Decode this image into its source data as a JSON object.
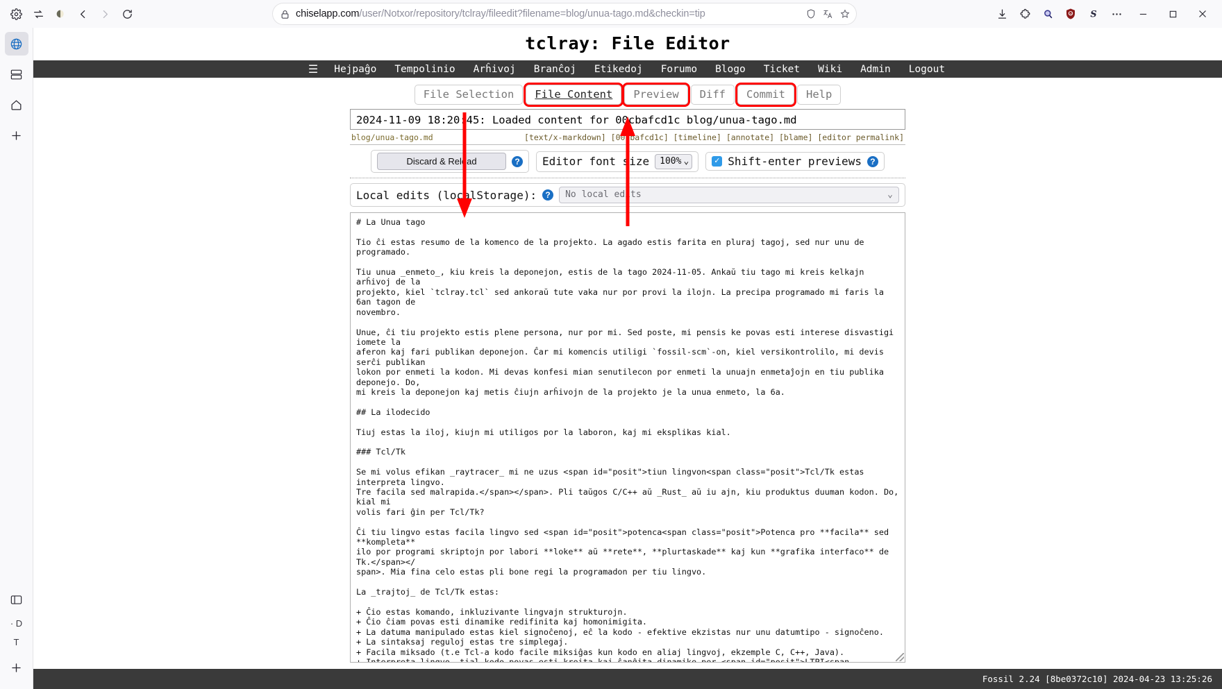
{
  "browser": {
    "url_host": "chiselapp.com",
    "url_path": "/user/Notxor/repository/tclray/fileedit?filename=blog/unua-tago.md&checkin=tip",
    "icons": {
      "settings": "gear-icon",
      "sync": "sync-icon",
      "profile": "profile-icon",
      "back": "back-arrow-icon",
      "forward": "forward-arrow-icon",
      "reload": "reload-icon",
      "lock": "lock-icon",
      "shield": "shield-icon",
      "translate": "translate-icon",
      "bookmark": "star-icon",
      "downloads": "download-icon",
      "extensions": "extensions-icon",
      "search": "search-icon",
      "ublock": "ublock-origin-icon",
      "stylus": "stylus-icon",
      "overflow": "more-options-icon",
      "minimize": "minimize-icon",
      "maximize": "maximize-icon",
      "close": "close-icon"
    },
    "sidebar": {
      "items": [
        {
          "name": "web-panel-icon",
          "glyph": "globe"
        },
        {
          "name": "tab-stack-icon",
          "glyph": "stack"
        },
        {
          "name": "home-icon",
          "glyph": "home"
        },
        {
          "name": "add-icon",
          "glyph": "plus"
        }
      ],
      "bottom": [
        {
          "name": "panel-toggle-icon",
          "glyph": "panel"
        },
        {
          "name": "workspace-d-label",
          "glyph": "text",
          "label": "· D"
        },
        {
          "name": "workspace-t-label",
          "glyph": "text",
          "label": "T"
        },
        {
          "name": "add-workspace-icon",
          "glyph": "plus"
        }
      ]
    }
  },
  "page": {
    "title": "tclray: File Editor",
    "nav": [
      {
        "label": "☰",
        "name": "sidebar-menu"
      },
      {
        "label": "Hejpaĝo",
        "name": "home"
      },
      {
        "label": "Tempolinio",
        "name": "timeline"
      },
      {
        "label": "Arĥivoj",
        "name": "files"
      },
      {
        "label": "Branĉoj",
        "name": "branches"
      },
      {
        "label": "Etikedoj",
        "name": "tags"
      },
      {
        "label": "Forumo",
        "name": "forum"
      },
      {
        "label": "Blogo",
        "name": "blog"
      },
      {
        "label": "Ticket",
        "name": "ticket"
      },
      {
        "label": "Wiki",
        "name": "wiki"
      },
      {
        "label": "Admin",
        "name": "admin"
      },
      {
        "label": "Logout",
        "name": "logout"
      }
    ],
    "tabs": [
      {
        "label": "File Selection",
        "selected": false,
        "highlighted": false
      },
      {
        "label": "File Content",
        "selected": true,
        "highlighted": true
      },
      {
        "label": "Preview",
        "selected": false,
        "highlighted": true
      },
      {
        "label": "Diff",
        "selected": false,
        "highlighted": false
      },
      {
        "label": "Commit",
        "selected": false,
        "highlighted": true
      },
      {
        "label": "Help",
        "selected": false,
        "highlighted": false
      }
    ],
    "status_message": "2024-11-09 18:20:45: Loaded content for 00cbafcd1c blog/unua-tago.md",
    "meta_left": "blog/unua-tago.md",
    "meta_right": "[text/x-markdown] [00cbafcd1c] [timeline] [annotate] [blame] [editor permalink]",
    "toolbar": {
      "discard_label": "Discard & Reload",
      "help_glyph": "?",
      "font_size_label": "Editor font size",
      "font_size_value": "100%",
      "shift_enter_label": "Shift-enter previews",
      "shift_enter_checked": true,
      "check_glyph": "✓"
    },
    "local_edits": {
      "label": "Local edits (localStorage):",
      "select_value": "No local edits"
    },
    "editor_content": "# La Unua tago\n\nTio ĉi estas resumo de la komenco de la projekto. La agado estis farita en pluraj tagoj, sed nur unu de programado.\n\nTiu unua _enmeto_, kiu kreis la deponejon, estis de la tago 2024-11-05. Ankaŭ tiu tago mi kreis kelkajn arĥivoj de la\nprojekto, kiel `tclray.tcl` sed ankoraŭ tute vaka nur por provi la ilojn. La precipa programado mi faris la 6an tagon de\nnovembro.\n\nUnue, ĉi tiu projekto estis plene persona, nur por mi. Sed poste, mi pensis ke povas esti interese disvastigi iomete la\naferon kaj fari publikan deponejon. Ĉar mi komencis utiligi `fossil-scm`-on, kiel versikontrolilo, mi devis serĉi publikan\nlokon por enmeti la kodon. Mi devas konfesi mian senutilecon por enmeti la unuajn enmetaĵojn en tiu publika deponejo. Do,\nmi kreis la deponejon kaj metis ĉiujn arĥivojn de la projekto je la unua enmeto, la 6a.\n\n## La ilodecido\n\nTiuj estas la iloj, kiujn mi utiligos por la laboron, kaj mi eksplikas kial.\n\n### Tcl/Tk\n\nSe mi volus efikan _raytracer_ mi ne uzus <span id=\"posit\">tiun lingvon<span class=\"posit\">Tcl/Tk estas interpreta lingvo.\nTre facila sed malrapida.</span></span>. Pli taŭgos C/C++ aŭ _Rust_ aŭ iu ajn, kiu produktus duuman kodon. Do, kial mi\nvolis fari ĝin per Tcl/Tk?\n\nĈi tiu lingvo estas facila lingvo sed <span id=\"posit\">potenca<span class=\"posit\">Potenca pro **facila** sed **kompleta**\nilo por programi skriptojn por labori **loke** aŭ **rete**, **plurtaskade** kaj kun **grafika interfaco** de Tk.</span></\nspan>. Mia fina celo estas pli bone regi la programadon per tiu lingvo.\n\nLa _trajtoj_ de Tcl/Tk estas:\n\n+ Ĉio estas komando, inkluzivante lingvajn strukturojn.\n+ Ĉio ĉiam povas esti dinamike redifinita kaj homonimigita.\n+ La datuma manipulado estas kiel signoĉenoj, eĉ la kodo - efektive ekzistas nur unu datumtipo - signoĉeno.\n+ La sintaksaj reguloj estas tre simplegaj.\n+ Facila miksado (t.e Tcl-a kodo facile miksiĝas kun kodo en aliaj lingvoj, ekzemple C, C++, Java).\n+ Interpreta lingvo, tial kodo povas esti kreita kaj ŝanĝita dinamike per <span id=\"posit\">LTPI<span\nclass=\"posit\">**Legado-Taksado-Printado-Iteracio** _RPEL_ per la angla.</span></span>.\n+ Platforma sendependeco (Windows, Unix, Mac OS, ktp.).\n+ Natura proksimeco kun populara fenestrada (GUI) interfaco Tk.\n+ La kodo estas facile subtenebla. Tcl skriptoj ofte estas pli kompaktaj kaj legeblaj ol ekvivalentaj alilingvaj\nprogramoj.",
    "footer": "Fossil 2.24 [8be0372c10] 2024-04-23 13:25:26"
  },
  "annotations": {
    "accent": "#ff0000",
    "arrow_down_name": "annotation-arrow-down",
    "arrow_up_name": "annotation-arrow-up"
  }
}
